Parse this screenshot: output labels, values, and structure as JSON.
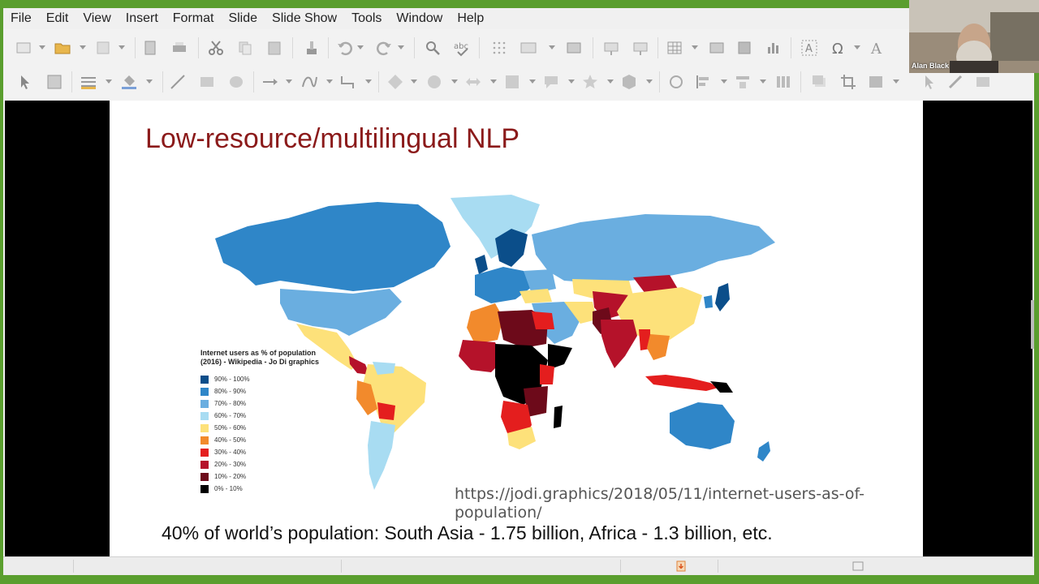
{
  "menubar": {
    "items": [
      "File",
      "Edit",
      "View",
      "Insert",
      "Format",
      "Slide",
      "Slide Show",
      "Tools",
      "Window",
      "Help"
    ]
  },
  "toolbar_icons": {
    "row1": [
      "new-slide-icon",
      "open-folder-icon",
      "save-icon",
      "export-pdf-icon",
      "print-icon",
      "cut-icon",
      "copy-icon",
      "paste-icon",
      "clone-format-icon",
      "undo-icon",
      "redo-icon",
      "find-replace-icon",
      "spellcheck-icon",
      "grid-icon",
      "display-views-icon",
      "master-slide-icon",
      "start-slideshow-icon",
      "start-from-current-icon",
      "table-icon",
      "image-icon",
      "media-icon",
      "chart-icon",
      "text-box-icon",
      "special-character-icon",
      "fontwork-icon"
    ],
    "row2": [
      "select-icon",
      "zoom-icon",
      "line-style-icon",
      "fill-color-icon",
      "line-icon",
      "rectangle-icon",
      "ellipse-icon",
      "arrow-icon",
      "curve-icon",
      "connector-icon",
      "basic-shapes-icon",
      "symbol-shapes-icon",
      "block-arrows-icon",
      "flowchart-icon",
      "callout-icon",
      "stars-icon",
      "3d-object-icon",
      "rotate-icon",
      "align-icon",
      "arrange-icon",
      "distribute-icon",
      "shadow-icon",
      "crop-icon",
      "filter-icon",
      "transformations-icon",
      "glue-points-icon"
    ]
  },
  "slide": {
    "title": "Low-resource/multilingual NLP",
    "legend": {
      "title": "Internet users as % of population (2016) - Wikipedia - Jo Di graphics",
      "items": [
        {
          "label": "90% - 100%",
          "color": "#0b4e8a"
        },
        {
          "label": "80% - 90%",
          "color": "#2f86c8"
        },
        {
          "label": "70% - 80%",
          "color": "#6aaee0"
        },
        {
          "label": "60% - 70%",
          "color": "#a8dcf2"
        },
        {
          "label": "50% - 60%",
          "color": "#fde17a"
        },
        {
          "label": "40% - 50%",
          "color": "#f28a2c"
        },
        {
          "label": "30% - 40%",
          "color": "#e41e1e"
        },
        {
          "label": "20% - 30%",
          "color": "#b5122a"
        },
        {
          "label": "10% - 20%",
          "color": "#6d0a1a"
        },
        {
          "label": "0% - 10%",
          "color": "#000000"
        }
      ]
    },
    "source_url": "https://jodi.graphics/2018/05/11/internet-users-as-of-population/",
    "caption": "40% of world’s population: South Asia - 1.75 billion, Africa - 1.3 billion, etc."
  },
  "webcam": {
    "participant_name": "Alan Black"
  }
}
